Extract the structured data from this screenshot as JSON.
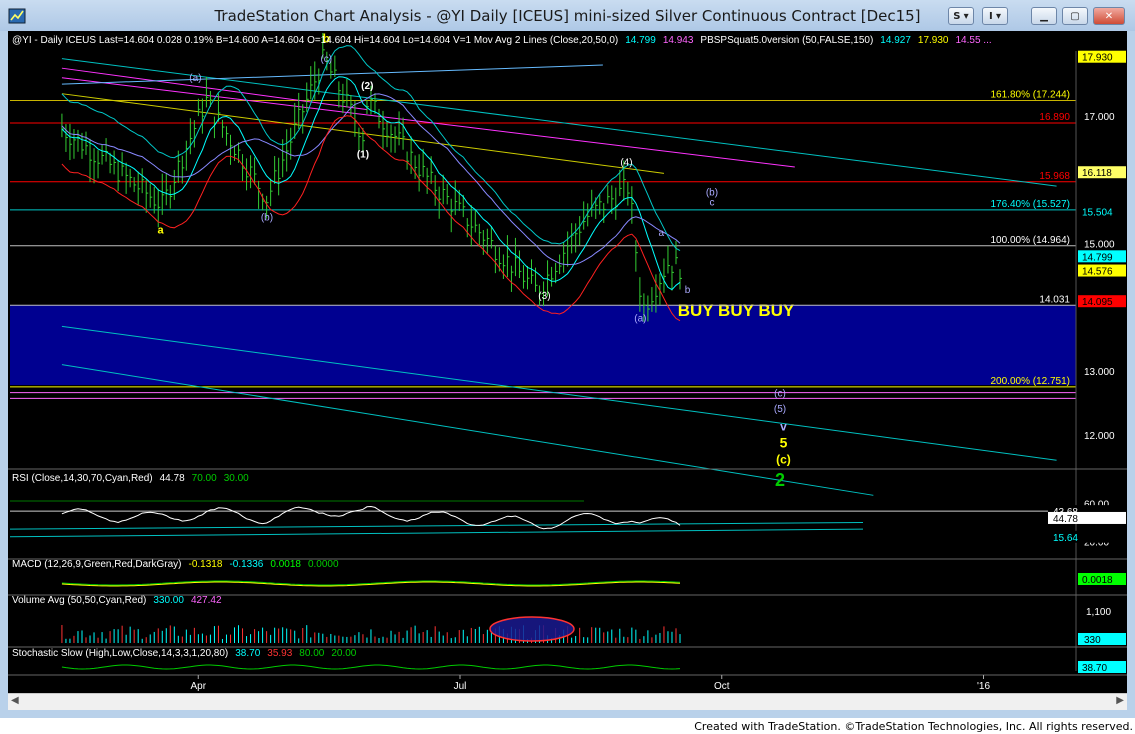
{
  "window": {
    "title": "TradeStation Chart Analysis - @YI Daily [ICEUS] mini-sized Silver Continuous Contract [Dec15]",
    "btn_s": "S",
    "btn_i": "I"
  },
  "header": {
    "symbol_line": "@YI - Daily  ICEUS  Last=14.604  0.028  0.19%  B=14.600  A=14.604  O=14.604  Hi=14.604  Lo=14.604  V=1  Mov Avg 2 Lines (Close,20,50,0)",
    "mav1": "14.799",
    "mav2": "14.943",
    "indicator": "PBSPSquat5.0version (50,FALSE,150)",
    "ind1": "14.927",
    "ind2": "17.930",
    "ind3": "14.55 ..."
  },
  "price_axis": {
    "ticks": [
      {
        "label": "17.000",
        "price": 17.0
      },
      {
        "label": "15.000",
        "price": 15.0
      },
      {
        "label": "13.000",
        "price": 13.0
      },
      {
        "label": "12.000",
        "price": 12.0
      }
    ],
    "tags": [
      {
        "label": "17.930",
        "price": 17.93,
        "bg": "#ffff00",
        "fg": "#000000"
      },
      {
        "label": "16.118",
        "price": 16.118,
        "bg": "#ffff66",
        "fg": "#000000"
      },
      {
        "label": "15.504",
        "price": 15.504,
        "bg": "#000000",
        "fg": "#00ffff"
      },
      {
        "label": "14.799",
        "price": 14.799,
        "bg": "#00ffff",
        "fg": "#000000"
      },
      {
        "label": "14.576",
        "price": 14.576,
        "bg": "#ffff00",
        "fg": "#000000"
      },
      {
        "label": "14.095",
        "price": 14.095,
        "bg": "#ff0000",
        "fg": "#000000"
      }
    ]
  },
  "levels": [
    {
      "label": "161.80% (17.244)",
      "price": 17.244,
      "color": "#c8b400",
      "text_color": "#ffff00"
    },
    {
      "label": "16.890",
      "price": 16.89,
      "color": "#ff0000",
      "text_color": "#ff0000"
    },
    {
      "label": "15.968",
      "price": 15.968,
      "color": "#ff0000",
      "text_color": "#ff0000"
    },
    {
      "label": "176.40% (15.527)",
      "price": 15.527,
      "color": "#00c8c8",
      "text_color": "#00ffff"
    },
    {
      "label": "100.00% (14.964)",
      "price": 14.964,
      "color": "#c0c0c0",
      "text_color": "#ffffff"
    },
    {
      "label": "14.031",
      "price": 14.031,
      "color": "#c0c0c0",
      "text_color": "#ffffff"
    },
    {
      "label": "200.00% (12.751)",
      "price": 12.751,
      "color": "#ffff00",
      "text_color": "#ffff00"
    }
  ],
  "zone": {
    "label": "BUY BUY BUY",
    "top": 14.03,
    "bottom": 12.78,
    "color": "#000090",
    "label_color": "#ffff00"
  },
  "time_axis": [
    {
      "label": "Apr",
      "month": 1
    },
    {
      "label": "Jul",
      "month": 4
    },
    {
      "label": "Oct",
      "month": 7
    },
    {
      "label": "'16",
      "month": 10
    }
  ],
  "wave_labels": [
    {
      "text": "b",
      "m": 2.33,
      "p": 18.15,
      "color": "#ffff00",
      "size": 12,
      "bold": true
    },
    {
      "text": "(c)",
      "m": 2.33,
      "p": 17.85,
      "color": "#aaaaff",
      "size": 10
    },
    {
      "text": "(a)",
      "m": 0.83,
      "p": 17.55,
      "color": "#aaaaff",
      "size": 10
    },
    {
      "text": "(2)",
      "m": 2.8,
      "p": 17.42,
      "color": "#ffffff",
      "size": 10,
      "bold": true
    },
    {
      "text": "(1)",
      "m": 2.75,
      "p": 16.35,
      "color": "#ffffff",
      "size": 10,
      "bold": true
    },
    {
      "text": "(b)",
      "m": 1.65,
      "p": 15.36,
      "color": "#aaaaff",
      "size": 10
    },
    {
      "text": "a",
      "m": 0.43,
      "p": 15.16,
      "color": "#ffff00",
      "size": 11,
      "bold": true
    },
    {
      "text": "(4)",
      "m": 5.77,
      "p": 16.22,
      "color": "#ffffff",
      "size": 10
    },
    {
      "text": "(b)",
      "m": 6.75,
      "p": 15.75,
      "color": "#aaaaff",
      "size": 10
    },
    {
      "text": "c",
      "m": 6.75,
      "p": 15.6,
      "color": "#aaaaff",
      "size": 10
    },
    {
      "text": "a",
      "m": 6.17,
      "p": 15.12,
      "color": "#aaaaff",
      "size": 10
    },
    {
      "text": "b",
      "m": 6.47,
      "p": 14.22,
      "color": "#aaaaff",
      "size": 10
    },
    {
      "text": "(3)",
      "m": 4.83,
      "p": 14.13,
      "color": "#ffffff",
      "size": 10
    },
    {
      "text": "(a)",
      "m": 5.93,
      "p": 13.78,
      "color": "#aaaaff",
      "size": 10
    },
    {
      "text": "(c)",
      "m": 7.53,
      "p": 12.6,
      "color": "#aaaaff",
      "size": 10
    },
    {
      "text": "(5)",
      "m": 7.53,
      "p": 12.36,
      "color": "#aaaaff",
      "size": 10
    },
    {
      "text": "v",
      "m": 7.57,
      "p": 12.07,
      "color": "#aaaaff",
      "size": 12,
      "bold": true
    },
    {
      "text": "5",
      "m": 7.57,
      "p": 11.8,
      "color": "#ffff00",
      "size": 14,
      "bold": true
    },
    {
      "text": "(c)",
      "m": 7.57,
      "p": 11.55,
      "color": "#ffff00",
      "size": 12,
      "bold": true
    },
    {
      "text": "2",
      "m": 7.53,
      "p": 11.2,
      "color": "#00cc00",
      "size": 18,
      "bold": true
    }
  ],
  "rsi": {
    "title": "RSI (Close,14,30,70,Cyan,Red)",
    "value": "44.78",
    "ob": "70.00",
    "os": "30.00",
    "axis": [
      {
        "label": "60.00",
        "v": 60
      },
      {
        "label": "20.00",
        "v": 20
      }
    ],
    "tags": [
      {
        "label": "43.68",
        "v": 52,
        "bg": "#000000",
        "fg": "#ffffff"
      },
      {
        "label": "44.78",
        "v": 44.78,
        "bg": "#ffffff",
        "fg": "#000000"
      },
      {
        "label": "15.64",
        "v": 25,
        "bg": "#000000",
        "fg": "#00ffff"
      }
    ]
  },
  "macd": {
    "title": "MACD (12,26,9,Green,Red,DarkGray)",
    "macd": "-0.1318",
    "signal": "-0.1336",
    "hist": "0.0018",
    "zero": "0.0000",
    "tag": "0.0018"
  },
  "volume": {
    "title": "Volume Avg (50,50,Cyan,Red)",
    "v1": "330.00",
    "v2": "427.42",
    "axis_label": "1,100",
    "tag": "330"
  },
  "stochastic": {
    "title": "Stochastic Slow (High,Low,Close,14,3,3,1,20,80)",
    "k": "38.70",
    "d": "35.93",
    "high": "80.00",
    "low": "20.00",
    "tag": "38.70"
  },
  "footer": {
    "text": "Created with TradeStation. ©TradeStation Technologies, Inc. All rights reserved."
  },
  "colors": {
    "price_bars": "#33cc33",
    "ma20": "#00ffff",
    "ma50": "#8888ff",
    "band_upper": "#00c8c8",
    "band_lower": "#ff2020",
    "trend_magenta": "#ff33ff",
    "trend_yellow": "#cccc00",
    "trend_cyan": "#00c0c0"
  }
}
